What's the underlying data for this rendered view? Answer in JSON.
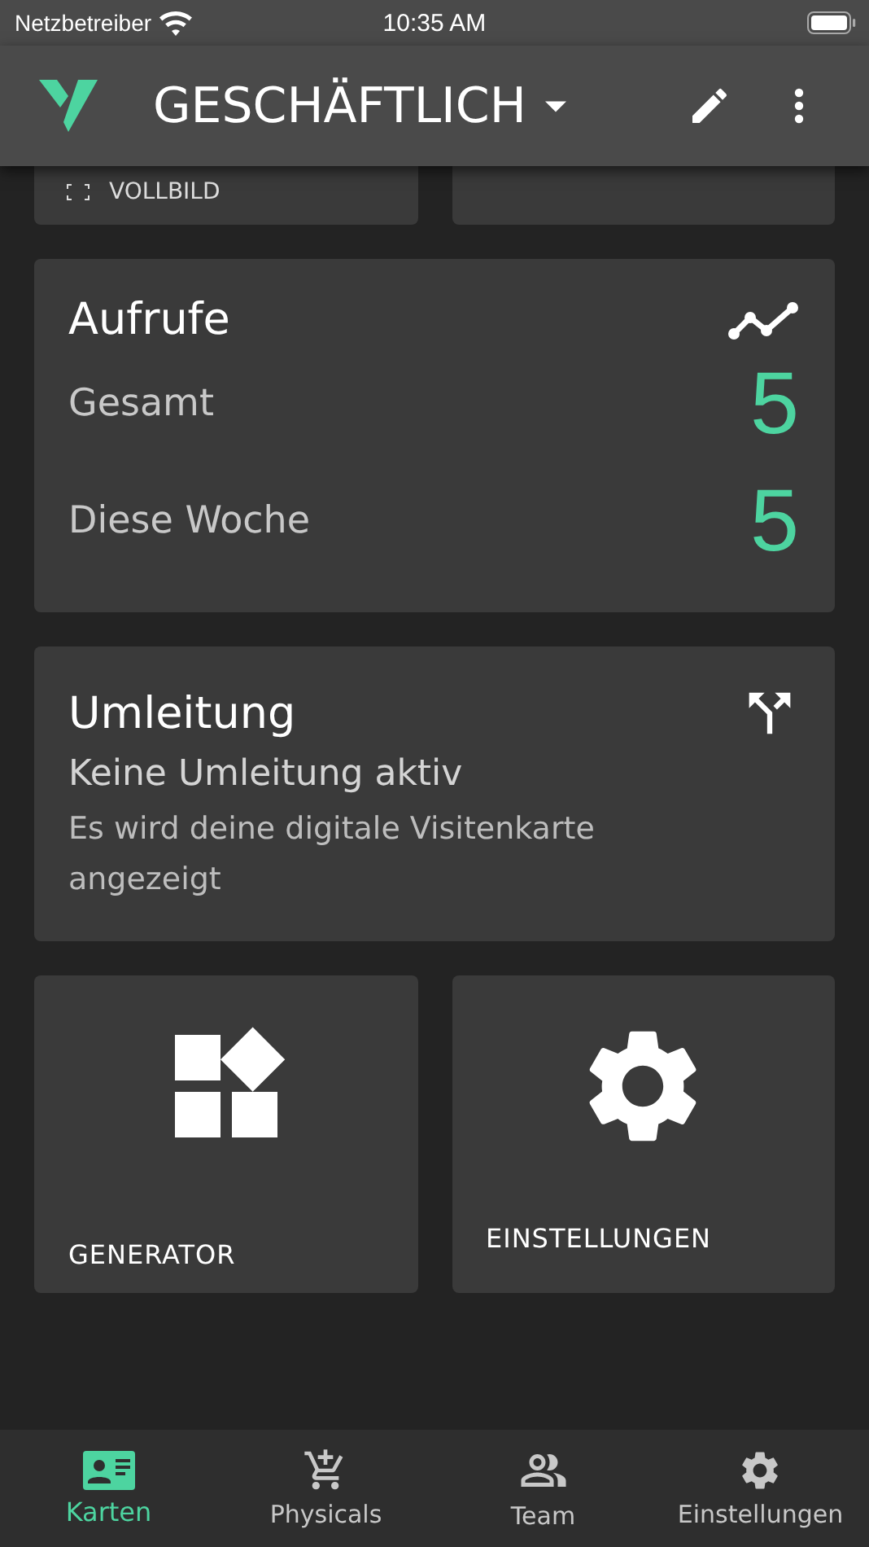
{
  "status_bar": {
    "carrier": "Netzbetreiber",
    "time": "10:35 AM"
  },
  "app_bar": {
    "title": "GESCHÄFTLICH"
  },
  "partial_tiles": [
    {
      "label": "VOLLBILD",
      "kind": "fullscreen"
    },
    {
      "kind": "blank"
    }
  ],
  "views_card": {
    "title": "Aufrufe",
    "rows": [
      {
        "label": "Gesamt",
        "value": "5"
      },
      {
        "label": "Diese Woche",
        "value": "5"
      }
    ]
  },
  "redirect_card": {
    "title": "Umleitung",
    "status": "Keine Umleitung aktiv",
    "description": "Es wird deine digitale Visitenkarte angezeigt"
  },
  "tiles": [
    {
      "label": "GENERATOR",
      "kind": "generator"
    },
    {
      "label": "EINSTELLUNGEN",
      "kind": "settings"
    }
  ],
  "bottom_nav": [
    {
      "label": "Karten",
      "kind": "card",
      "selected": true
    },
    {
      "label": "Physicals",
      "kind": "cart",
      "selected": false
    },
    {
      "label": "Team",
      "kind": "team",
      "selected": false
    },
    {
      "label": "Einstellungen",
      "kind": "gear",
      "selected": false
    }
  ]
}
